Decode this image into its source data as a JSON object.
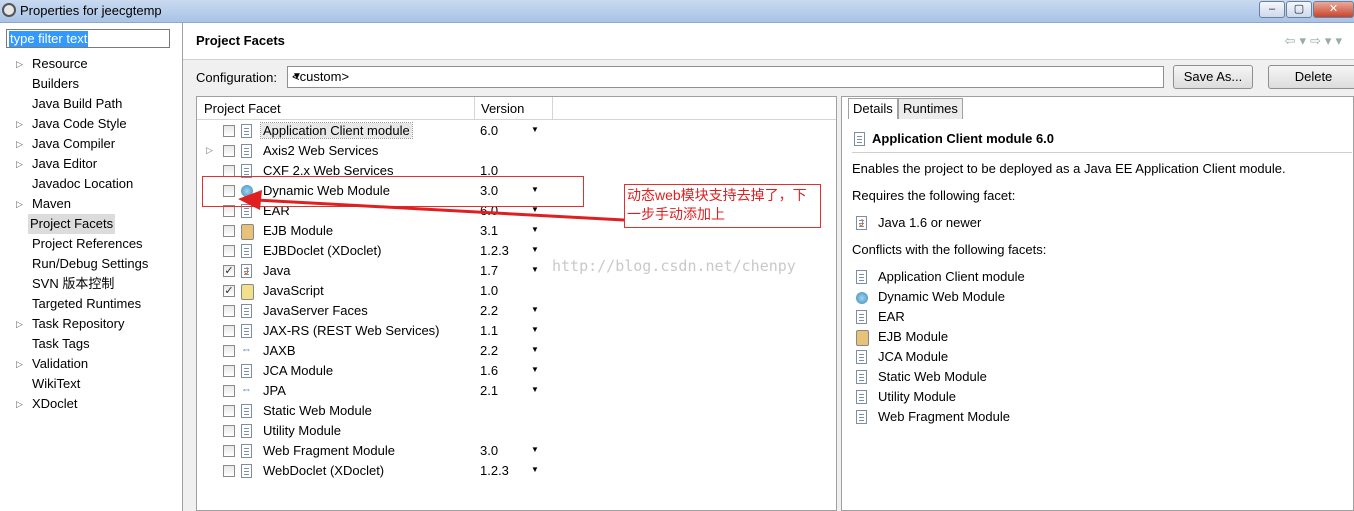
{
  "window": {
    "title": "Properties for jeecgtemp",
    "buttons": [
      "–",
      "▢",
      "✕"
    ]
  },
  "sidebar": {
    "filter_text": "type filter text",
    "items": [
      {
        "label": "Resource",
        "expandable": true
      },
      {
        "label": "Builders",
        "expandable": false
      },
      {
        "label": "Java Build Path",
        "expandable": false
      },
      {
        "label": "Java Code Style",
        "expandable": true
      },
      {
        "label": "Java Compiler",
        "expandable": true
      },
      {
        "label": "Java Editor",
        "expandable": true
      },
      {
        "label": "Javadoc Location",
        "expandable": false
      },
      {
        "label": "Maven",
        "expandable": true
      },
      {
        "label": "Project Facets",
        "expandable": false,
        "selected": true
      },
      {
        "label": "Project References",
        "expandable": false
      },
      {
        "label": "Run/Debug Settings",
        "expandable": false
      },
      {
        "label": "SVN 版本控制",
        "expandable": false
      },
      {
        "label": "Targeted Runtimes",
        "expandable": false
      },
      {
        "label": "Task Repository",
        "expandable": true
      },
      {
        "label": "Task Tags",
        "expandable": false
      },
      {
        "label": "Validation",
        "expandable": true
      },
      {
        "label": "WikiText",
        "expandable": false
      },
      {
        "label": "XDoclet",
        "expandable": true
      }
    ]
  },
  "header": {
    "title": "Project Facets",
    "nav_icons": "⇦▾⇨▾▾"
  },
  "config": {
    "label": "Configuration:",
    "value": "<custom>",
    "save_as": "Save As...",
    "delete": "Delete"
  },
  "facets": {
    "col_facet": "Project Facet",
    "col_version": "Version",
    "rows": [
      {
        "name": "Application Client module",
        "version": "6.0",
        "dropdown": true,
        "checked": false,
        "icon": "document-icon",
        "selected": true
      },
      {
        "name": "Axis2 Web Services",
        "version": "",
        "dropdown": false,
        "checked": false,
        "icon": "document-icon",
        "expand": true
      },
      {
        "name": "CXF 2.x Web Services",
        "version": "1.0",
        "dropdown": false,
        "checked": false,
        "icon": "document-icon"
      },
      {
        "name": "Dynamic Web Module",
        "version": "3.0",
        "dropdown": true,
        "checked": false,
        "icon": "globe-icon"
      },
      {
        "name": "EAR",
        "version": "6.0",
        "dropdown": true,
        "checked": false,
        "icon": "document-icon"
      },
      {
        "name": "EJB Module",
        "version": "3.1",
        "dropdown": true,
        "checked": false,
        "icon": "jar-icon"
      },
      {
        "name": "EJBDoclet (XDoclet)",
        "version": "1.2.3",
        "dropdown": true,
        "checked": false,
        "icon": "document-icon"
      },
      {
        "name": "Java",
        "version": "1.7",
        "dropdown": true,
        "checked": true,
        "icon": "java-icon"
      },
      {
        "name": "JavaScript",
        "version": "1.0",
        "dropdown": false,
        "checked": true,
        "icon": "javascript-icon"
      },
      {
        "name": "JavaServer Faces",
        "version": "2.2",
        "dropdown": true,
        "checked": false,
        "icon": "document-icon"
      },
      {
        "name": "JAX-RS (REST Web Services)",
        "version": "1.1",
        "dropdown": true,
        "checked": false,
        "icon": "document-icon"
      },
      {
        "name": "JAXB",
        "version": "2.2",
        "dropdown": true,
        "checked": false,
        "icon": "arrows-icon"
      },
      {
        "name": "JCA Module",
        "version": "1.6",
        "dropdown": true,
        "checked": false,
        "icon": "document-icon"
      },
      {
        "name": "JPA",
        "version": "2.1",
        "dropdown": true,
        "checked": false,
        "icon": "arrows-icon"
      },
      {
        "name": "Static Web Module",
        "version": "",
        "dropdown": false,
        "checked": false,
        "icon": "document-icon"
      },
      {
        "name": "Utility Module",
        "version": "",
        "dropdown": false,
        "checked": false,
        "icon": "document-icon"
      },
      {
        "name": "Web Fragment Module",
        "version": "3.0",
        "dropdown": true,
        "checked": false,
        "icon": "document-icon"
      },
      {
        "name": "WebDoclet (XDoclet)",
        "version": "1.2.3",
        "dropdown": true,
        "checked": false,
        "icon": "document-icon"
      }
    ]
  },
  "details": {
    "tabs": [
      "Details",
      "Runtimes"
    ],
    "title": "Application Client module 6.0",
    "description": "Enables the project to be deployed as a Java EE Application Client module.",
    "requires_label": "Requires the following facet:",
    "requires": [
      {
        "name": "Java 1.6 or newer",
        "icon": "java-icon"
      }
    ],
    "conflicts_label": "Conflicts with the following facets:",
    "conflicts": [
      {
        "name": "Application Client module",
        "icon": "document-icon"
      },
      {
        "name": "Dynamic Web Module",
        "icon": "globe-icon"
      },
      {
        "name": "EAR",
        "icon": "document-icon"
      },
      {
        "name": "EJB Module",
        "icon": "jar-icon"
      },
      {
        "name": "JCA Module",
        "icon": "document-icon"
      },
      {
        "name": "Static Web Module",
        "icon": "document-icon"
      },
      {
        "name": "Utility Module",
        "icon": "document-icon"
      },
      {
        "name": "Web Fragment Module",
        "icon": "document-icon"
      }
    ]
  },
  "annotation": {
    "note": "动态web模块支持去掉了，下一步手动添加上",
    "watermark": "http://blog.csdn.net/chenpy",
    "color": "#e03030"
  }
}
